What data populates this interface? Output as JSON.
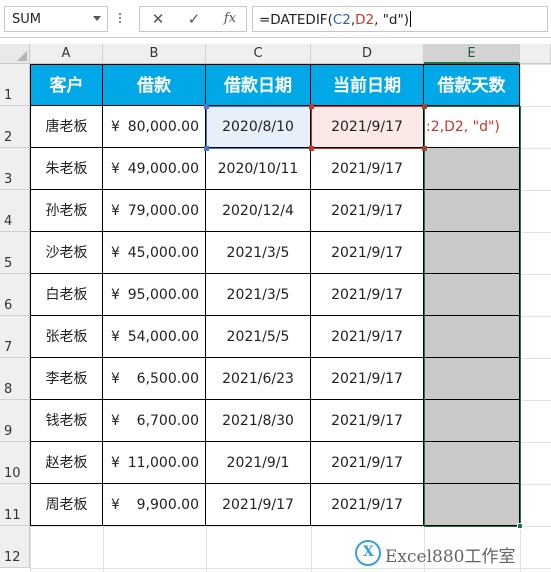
{
  "formula_bar": {
    "name_box": "SUM",
    "cancel_symbol": "✕",
    "enter_symbol": "✓",
    "fx_symbol": "fx",
    "formula_prefix": "=DATEDIF(",
    "ref1": "C2",
    "sep1": ",",
    "ref2": "D2",
    "formula_suffix": ", \"d\")"
  },
  "columns": [
    "A",
    "B",
    "C",
    "D",
    "E"
  ],
  "rows": [
    "1",
    "2",
    "3",
    "4",
    "5",
    "6",
    "7",
    "8",
    "9",
    "10",
    "11",
    "12"
  ],
  "header": {
    "customer": "客户",
    "loan": "借款",
    "loan_date": "借款日期",
    "current_date": "当前日期",
    "loan_days": "借款天数"
  },
  "currency_symbol": "¥",
  "data_rows": [
    {
      "customer": "唐老板",
      "amount": "80,000.00",
      "loan_date": "2020/8/10",
      "current_date": "2021/9/17"
    },
    {
      "customer": "朱老板",
      "amount": "49,000.00",
      "loan_date": "2020/10/11",
      "current_date": "2021/9/17"
    },
    {
      "customer": "孙老板",
      "amount": "79,000.00",
      "loan_date": "2020/12/4",
      "current_date": "2021/9/17"
    },
    {
      "customer": "沙老板",
      "amount": "45,000.00",
      "loan_date": "2021/3/5",
      "current_date": "2021/9/17"
    },
    {
      "customer": "白老板",
      "amount": "95,000.00",
      "loan_date": "2021/3/5",
      "current_date": "2021/9/17"
    },
    {
      "customer": "张老板",
      "amount": "54,000.00",
      "loan_date": "2021/5/5",
      "current_date": "2021/9/17"
    },
    {
      "customer": "李老板",
      "amount": "6,500.00",
      "loan_date": "2021/6/23",
      "current_date": "2021/9/17"
    },
    {
      "customer": "钱老板",
      "amount": "6,700.00",
      "loan_date": "2021/8/30",
      "current_date": "2021/9/17"
    },
    {
      "customer": "赵老板",
      "amount": "11,000.00",
      "loan_date": "2021/9/1",
      "current_date": "2021/9/17"
    },
    {
      "customer": "周老板",
      "amount": "9,900.00",
      "loan_date": "2021/9/17",
      "current_date": "2021/9/17"
    }
  ],
  "e2_overflow_text": ":2,D2, \"d\")",
  "colors": {
    "header_bg": "#00a8e8",
    "ref1_color": "#2e5fb8",
    "ref2_color": "#c0392b",
    "selection_green": "#217346",
    "selected_fill": "#c9c9c9"
  },
  "watermark": {
    "logo_glyph": "X",
    "text": "Excel880工作室"
  }
}
